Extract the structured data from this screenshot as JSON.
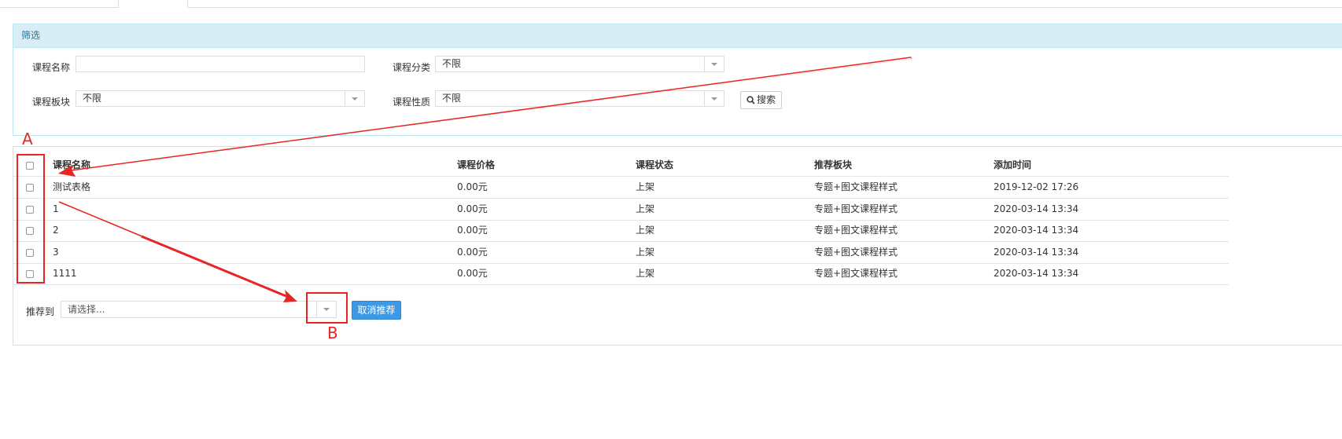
{
  "filter": {
    "title": "筛选",
    "name_label": "课程名称",
    "name_value": "",
    "category_label": "课程分类",
    "category_value": "不限",
    "section_label": "课程板块",
    "section_value": "不限",
    "nature_label": "课程性质",
    "nature_value": "不限",
    "search_label": "搜索"
  },
  "table": {
    "headers": [
      "课程名称",
      "课程价格",
      "课程状态",
      "推荐板块",
      "添加时间"
    ],
    "rows": [
      [
        "测试表格",
        "0.00元",
        "上架",
        "专题+图文课程样式",
        "2019-12-02 17:26"
      ],
      [
        "1",
        "0.00元",
        "上架",
        "专题+图文课程样式",
        "2020-03-14 13:34"
      ],
      [
        "2",
        "0.00元",
        "上架",
        "专题+图文课程样式",
        "2020-03-14 13:34"
      ],
      [
        "3",
        "0.00元",
        "上架",
        "专题+图文课程样式",
        "2020-03-14 13:34"
      ],
      [
        "1111",
        "0.00元",
        "上架",
        "专题+图文课程样式",
        "2020-03-14 13:34"
      ]
    ]
  },
  "recommend": {
    "label": "推荐到",
    "placeholder": "请选择...",
    "cancel_label": "取消推荐"
  },
  "annotations": {
    "a": "A",
    "b": "B",
    "color": "#e82424"
  },
  "icons": {
    "search": "search-icon",
    "dropdown": "chevron-down-icon"
  }
}
